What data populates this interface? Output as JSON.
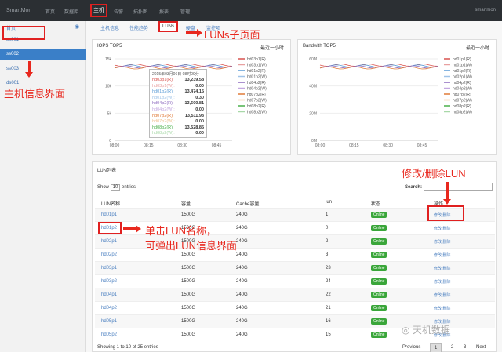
{
  "topbar": {
    "logo": "SmartMon",
    "nav": [
      "首页",
      "数据库",
      "主机",
      "告警",
      "拓扑图",
      "报表",
      "管理"
    ],
    "right": "smartmon"
  },
  "sidebar": {
    "title": "首页",
    "items": [
      "ss001",
      "ss002",
      "ss003",
      "ds001"
    ]
  },
  "tabs": [
    "主机信息",
    "性能趋势",
    "LUNs",
    "硬盘",
    "监控项"
  ],
  "iops": {
    "title": "IOPS TOP5",
    "range": "最近一小时",
    "ylabels": [
      "15k",
      "10k",
      "5k",
      "0"
    ],
    "xlabels": [
      "08:00",
      "08:15",
      "08:30",
      "08:45"
    ],
    "legend": [
      "hd03p1(R)",
      "hd03p1(W)",
      "hd01p2(R)",
      "hd01p2(W)",
      "hd04p2(R)",
      "hd04p2(W)",
      "hd07p2(R)",
      "hd07p2(W)",
      "hd08p2(R)",
      "hd08p2(W)"
    ],
    "tooltip": {
      "title": "2015年03月06日 08时09分",
      "rows": [
        {
          "name": "hd03p1(R):",
          "value": "13,239.58"
        },
        {
          "name": "hd03p1(W):",
          "value": "0.00"
        },
        {
          "name": "hd01p2(R):",
          "value": "13,474.15"
        },
        {
          "name": "hd01p2(W):",
          "value": "0.30"
        },
        {
          "name": "hd04p2(R):",
          "value": "13,600.81"
        },
        {
          "name": "hd04p2(W):",
          "value": "0.00"
        },
        {
          "name": "hd07p2(R):",
          "value": "13,511.98"
        },
        {
          "name": "hd07p2(W):",
          "value": "0.00"
        },
        {
          "name": "hd08p2(R):",
          "value": "13,528.85"
        },
        {
          "name": "hd08p2(W):",
          "value": "0.00"
        }
      ]
    }
  },
  "bw": {
    "title": "Bandwith TOP5",
    "range": "最近一小时",
    "ylabels": [
      "60M",
      "40M",
      "20M",
      "0M"
    ],
    "xlabels": [
      "08:00",
      "08:15",
      "08:30",
      "08:45"
    ],
    "legend": [
      "hd01p1(R)",
      "hd01p1(W)",
      "hd01p2(R)",
      "hd02p1(W)",
      "hd04p2(R)",
      "hd04p2(W)",
      "hd07p2(R)",
      "hd07p2(W)",
      "hd08p2(R)",
      "hd08p2(W)"
    ]
  },
  "lun": {
    "title": "LUN列表",
    "show": "Show",
    "entries_val": "10",
    "entries": "entries",
    "search": "Search:",
    "headers": [
      "LUN名称",
      "容量",
      "Cache容量",
      "lun",
      "状态",
      "操作"
    ],
    "rows": [
      {
        "name": "hd01p1",
        "cap": "1500G",
        "cache": "240G",
        "lun": "1",
        "status": "Online",
        "ops": "修改 删除"
      },
      {
        "name": "hd01p2",
        "cap": "1500G",
        "cache": "240G",
        "lun": "0",
        "status": "Online",
        "ops": "修改 删除"
      },
      {
        "name": "hd02p1",
        "cap": "1500G",
        "cache": "240G",
        "lun": "2",
        "status": "Online",
        "ops": "修改 删除"
      },
      {
        "name": "hd02p2",
        "cap": "1500G",
        "cache": "240G",
        "lun": "3",
        "status": "Online",
        "ops": "修改 删除"
      },
      {
        "name": "hd03p1",
        "cap": "1500G",
        "cache": "240G",
        "lun": "23",
        "status": "Online",
        "ops": "修改 删除"
      },
      {
        "name": "hd03p2",
        "cap": "1500G",
        "cache": "240G",
        "lun": "24",
        "status": "Online",
        "ops": "修改 删除"
      },
      {
        "name": "hd04p1",
        "cap": "1500G",
        "cache": "240G",
        "lun": "22",
        "status": "Online",
        "ops": "修改 删除"
      },
      {
        "name": "hd04p2",
        "cap": "1500G",
        "cache": "240G",
        "lun": "21",
        "status": "Online",
        "ops": "修改 删除"
      },
      {
        "name": "hd05p1",
        "cap": "1500G",
        "cache": "240G",
        "lun": "16",
        "status": "Online",
        "ops": "修改 删除"
      },
      {
        "name": "hd05p2",
        "cap": "1500G",
        "cache": "240G",
        "lun": "15",
        "status": "Online",
        "ops": "修改 删除"
      }
    ],
    "footer": "Showing 1 to 10 of 25 entries",
    "pager": [
      "Previous",
      "1",
      "2",
      "3",
      "Next"
    ]
  },
  "annotations": {
    "host": "主机信息界面",
    "luns": "LUNs子页面",
    "edit": "修改/删除LUN",
    "click1": "单击LUN名称，",
    "click2": "可弹出LUN信息界面"
  },
  "watermark": "天机数据",
  "colors": {
    "accent": "#e8281e",
    "topbar": "#2b2f33",
    "active": "#3a7fc8",
    "online": "#3aa63a"
  }
}
